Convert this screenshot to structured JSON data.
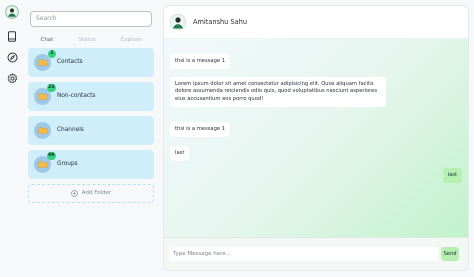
{
  "rail": {
    "icons": [
      "user-avatar",
      "book-icon",
      "compass-icon",
      "settings-icon"
    ]
  },
  "sidebar": {
    "search_placeholder": "Search",
    "tabs": [
      {
        "label": "Chat",
        "active": true
      },
      {
        "label": "Status",
        "active": false
      },
      {
        "label": "Explore",
        "active": false
      }
    ],
    "folders": [
      {
        "name": "Contacts",
        "badge": "2"
      },
      {
        "name": "Non-contacts",
        "badge": "23"
      },
      {
        "name": "Channels",
        "badge": ""
      },
      {
        "name": "Groups",
        "badge": "99"
      }
    ],
    "add_folder_label": "Add Folder"
  },
  "chat": {
    "contact_name": "Amitanshu Sahu",
    "messages": [
      {
        "text": "thsi is a message 1",
        "direction": "in"
      },
      {
        "text": "Lorem ipsum dolor sit amet consectetur adipisicing elit. Quos aliquam facilis dolore assumenda reiciendis odio quis, quod voluptatibus nesciunt asperiores eius accusantium eos porro quod!",
        "direction": "in"
      },
      {
        "text": "thsi is a message 1",
        "direction": "in"
      },
      {
        "text": "last",
        "direction": "in"
      },
      {
        "text": "last",
        "direction": "out"
      }
    ],
    "composer_placeholder": "Type Message here...",
    "send_label": "Send"
  },
  "colors": {
    "folder_bg": "#cfeefa",
    "badge": "#34d17e",
    "outgoing_bubble": "#b6f0b1",
    "send_button": "#b6f0b1"
  }
}
